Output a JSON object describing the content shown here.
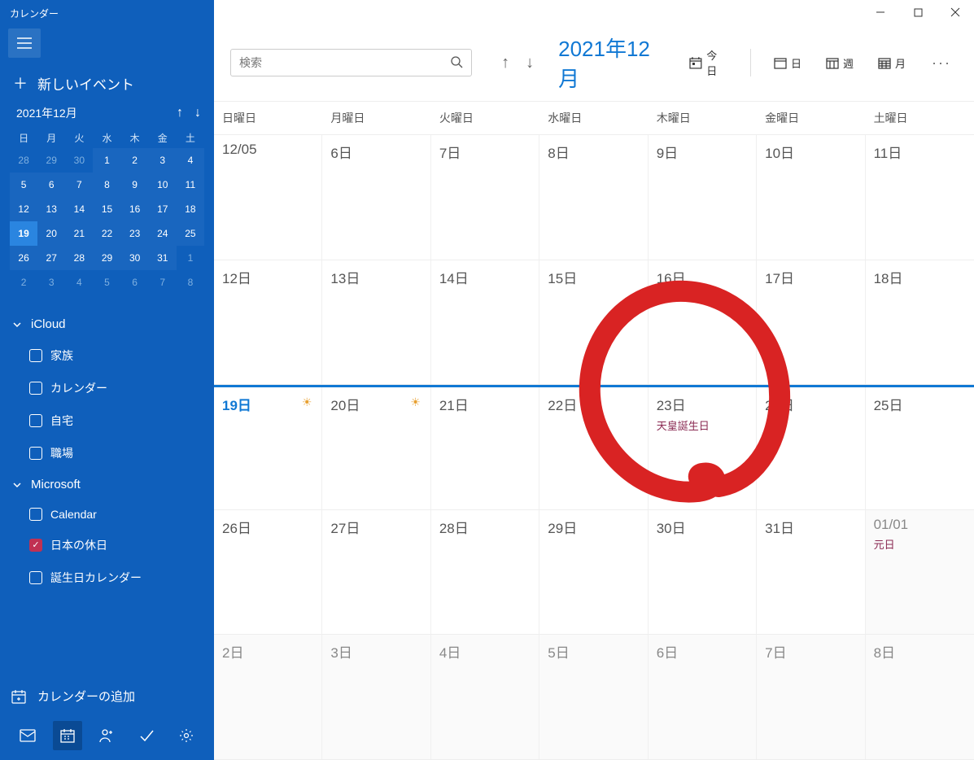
{
  "app_title": "カレンダー",
  "new_event_label": "新しいイベント",
  "mini": {
    "label": "2021年12月",
    "dow": [
      "日",
      "月",
      "火",
      "水",
      "木",
      "金",
      "土"
    ],
    "rows": [
      {
        "cells": [
          "28",
          "29",
          "30",
          "1",
          "2",
          "3",
          "4"
        ],
        "dim": [
          0,
          1,
          2
        ],
        "curr": [
          3,
          4,
          5,
          6
        ]
      },
      {
        "cells": [
          "5",
          "6",
          "7",
          "8",
          "9",
          "10",
          "11"
        ],
        "curr": [
          0,
          1,
          2,
          3,
          4,
          5,
          6
        ]
      },
      {
        "cells": [
          "12",
          "13",
          "14",
          "15",
          "16",
          "17",
          "18"
        ],
        "curr": [
          0,
          1,
          2,
          3,
          4,
          5,
          6
        ]
      },
      {
        "cells": [
          "19",
          "20",
          "21",
          "22",
          "23",
          "24",
          "25"
        ],
        "curr": [
          0,
          1,
          2,
          3,
          4,
          5,
          6
        ],
        "today": 0
      },
      {
        "cells": [
          "26",
          "27",
          "28",
          "29",
          "30",
          "31",
          "1"
        ],
        "curr": [
          0,
          1,
          2,
          3,
          4,
          5
        ],
        "dim": [
          6
        ]
      },
      {
        "cells": [
          "2",
          "3",
          "4",
          "5",
          "6",
          "7",
          "8"
        ],
        "dim": [
          0,
          1,
          2,
          3,
          4,
          5,
          6
        ]
      }
    ]
  },
  "accounts": [
    {
      "name": "iCloud",
      "cals": [
        {
          "label": "家族",
          "checked": false
        },
        {
          "label": "カレンダー",
          "checked": false
        },
        {
          "label": "自宅",
          "checked": false
        },
        {
          "label": "職場",
          "checked": false
        }
      ]
    },
    {
      "name": "Microsoft",
      "cals": [
        {
          "label": "Calendar",
          "checked": false
        },
        {
          "label": "日本の休日",
          "checked": true
        },
        {
          "label": "誕生日カレンダー",
          "checked": false
        }
      ]
    }
  ],
  "add_calendar_label": "カレンダーの追加",
  "search_placeholder": "検索",
  "month_title": "2021年12月",
  "today_btn": "今日",
  "view_day": "日",
  "view_week": "週",
  "view_month": "月",
  "dow_full": [
    "日曜日",
    "月曜日",
    "火曜日",
    "水曜日",
    "木曜日",
    "金曜日",
    "土曜日"
  ],
  "weeks": [
    {
      "days": [
        {
          "label": "12/05"
        },
        {
          "label": "6日"
        },
        {
          "label": "7日"
        },
        {
          "label": "8日"
        },
        {
          "label": "9日"
        },
        {
          "label": "10日"
        },
        {
          "label": "11日"
        }
      ]
    },
    {
      "days": [
        {
          "label": "12日"
        },
        {
          "label": "13日"
        },
        {
          "label": "14日"
        },
        {
          "label": "15日"
        },
        {
          "label": "16日"
        },
        {
          "label": "17日"
        },
        {
          "label": "18日"
        }
      ]
    },
    {
      "current": true,
      "days": [
        {
          "label": "19日",
          "today": true,
          "sun": true
        },
        {
          "label": "20日",
          "sun": true
        },
        {
          "label": "21日"
        },
        {
          "label": "22日"
        },
        {
          "label": "23日",
          "holiday": "天皇誕生日"
        },
        {
          "label": "24日"
        },
        {
          "label": "25日"
        }
      ]
    },
    {
      "days": [
        {
          "label": "26日"
        },
        {
          "label": "27日"
        },
        {
          "label": "28日"
        },
        {
          "label": "29日"
        },
        {
          "label": "30日"
        },
        {
          "label": "31日"
        },
        {
          "label": "01/01",
          "holiday": "元日",
          "other": true
        }
      ]
    },
    {
      "days": [
        {
          "label": "2日",
          "other": true
        },
        {
          "label": "3日",
          "other": true
        },
        {
          "label": "4日",
          "other": true
        },
        {
          "label": "5日",
          "other": true
        },
        {
          "label": "6日",
          "other": true
        },
        {
          "label": "7日",
          "other": true
        },
        {
          "label": "8日",
          "other": true
        }
      ]
    }
  ]
}
